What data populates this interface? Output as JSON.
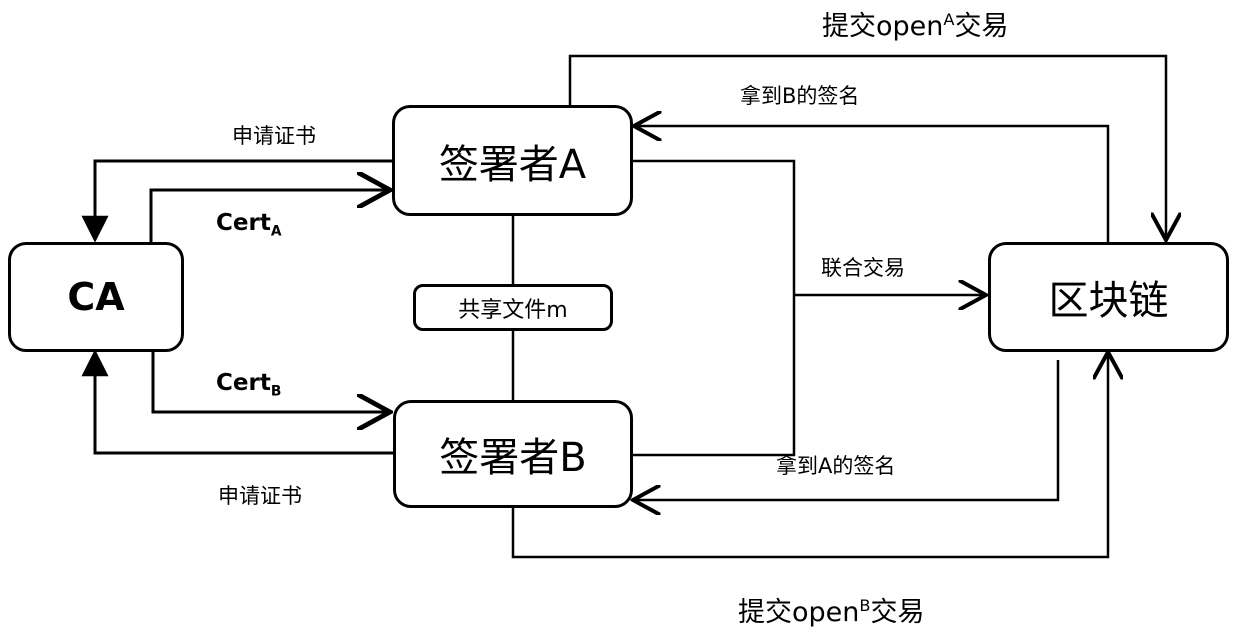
{
  "nodes": {
    "ca": "CA",
    "signer_a": "签署者A",
    "signer_b": "签署者B",
    "shared_file": "共享文件m",
    "blockchain": "区块链"
  },
  "edges": {
    "apply_cert_a": "申请证书",
    "cert_a": {
      "base": "Cert",
      "sub": "A"
    },
    "cert_b": {
      "base": "Cert",
      "sub": "B"
    },
    "apply_cert_b": "申请证书",
    "joint_tx": "联合交易",
    "get_b_sig": "拿到B的签名",
    "get_a_sig": "拿到A的签名",
    "submit_open_a": {
      "pre": "提交open",
      "sup": "A",
      "post": "交易"
    },
    "submit_open_b": {
      "pre": "提交open",
      "sup": "B",
      "post": "交易"
    }
  },
  "colors": {
    "line": "#000000",
    "background": "#ffffff"
  }
}
